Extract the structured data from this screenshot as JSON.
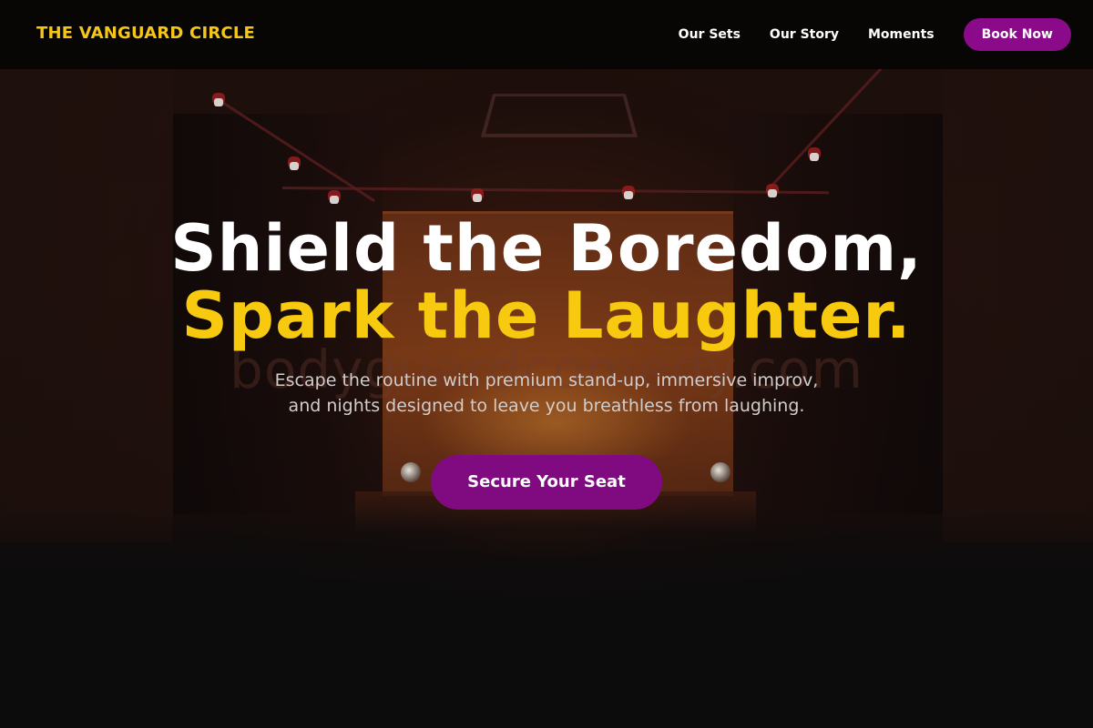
{
  "header": {
    "brand": "THE VANGUARD CIRCLE",
    "nav": [
      {
        "label": "Our Sets"
      },
      {
        "label": "Our Story"
      },
      {
        "label": "Moments"
      }
    ],
    "cta_label": "Book Now"
  },
  "hero": {
    "headline_line1": "Shield the Boredom,",
    "headline_line2": "Spark the Laughter.",
    "subtitle_line1": "Escape the routine with premium stand-up, immersive improv,",
    "subtitle_line2": "and nights designed to leave you breathless from laughing.",
    "cta_label": "Secure Your Seat"
  },
  "background": {
    "watermark": "bodyguardcomedy.com"
  },
  "colors": {
    "accent_yellow": "#f5c518",
    "accent_purple": "#8a0a8a",
    "background": "#0d0c0c",
    "text_white": "#ffffff"
  }
}
